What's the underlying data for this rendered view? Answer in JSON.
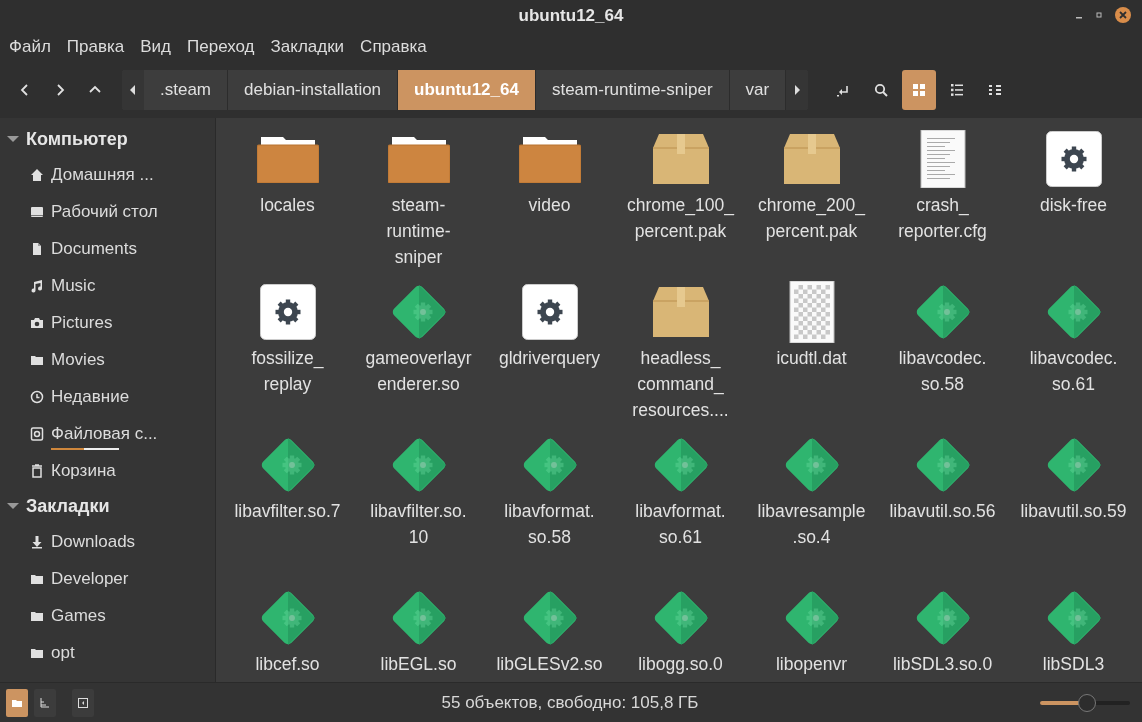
{
  "window": {
    "title": "ubuntu12_64"
  },
  "menu": [
    "Файл",
    "Правка",
    "Вид",
    "Переход",
    "Закладки",
    "Справка"
  ],
  "breadcrumbs": [
    {
      "label": ".steam",
      "selected": false
    },
    {
      "label": "debian-installation",
      "selected": false
    },
    {
      "label": "ubuntu12_64",
      "selected": true
    },
    {
      "label": "steam-runtime-sniper",
      "selected": false
    },
    {
      "label": "var",
      "selected": false
    }
  ],
  "view_buttons": [
    {
      "kind": "icons",
      "selected": true
    },
    {
      "kind": "list",
      "selected": false
    },
    {
      "kind": "compact",
      "selected": false
    }
  ],
  "sidebar": {
    "sections": [
      {
        "title": "Компьютер",
        "expanded": true,
        "items": [
          {
            "kind": "home",
            "label": "Домашняя ..."
          },
          {
            "kind": "desktop",
            "label": "Рабочий стол"
          },
          {
            "kind": "document",
            "label": "Documents"
          },
          {
            "kind": "music",
            "label": "Music"
          },
          {
            "kind": "camera",
            "label": "Pictures"
          },
          {
            "kind": "folder",
            "label": "Movies"
          },
          {
            "kind": "clock",
            "label": "Недавние"
          },
          {
            "kind": "drive",
            "label": "Файловая с...",
            "level": 0.48
          },
          {
            "kind": "trash",
            "label": "Корзина"
          }
        ]
      },
      {
        "title": "Закладки",
        "expanded": true,
        "items": [
          {
            "kind": "download",
            "label": "Downloads"
          },
          {
            "kind": "folder",
            "label": "Developer"
          },
          {
            "kind": "folder",
            "label": "Games"
          },
          {
            "kind": "folder",
            "label": "opt"
          }
        ]
      }
    ]
  },
  "files": [
    {
      "name": "locales",
      "kind": "folder"
    },
    {
      "name": "steam-runtime-sniper",
      "kind": "folder"
    },
    {
      "name": "video",
      "kind": "folder"
    },
    {
      "name": "chrome_100_percent.pak",
      "kind": "package"
    },
    {
      "name": "chrome_200_percent.pak",
      "kind": "package"
    },
    {
      "name": "crash_reporter.cfg",
      "kind": "text"
    },
    {
      "name": "disk-free",
      "kind": "executable"
    },
    {
      "name": "fossilize_replay",
      "kind": "executable"
    },
    {
      "name": "gameoverlayrenderer.so",
      "kind": "library"
    },
    {
      "name": "gldriverquery",
      "kind": "executable"
    },
    {
      "name": "headless_command_resources....",
      "kind": "package"
    },
    {
      "name": "icudtl.dat",
      "kind": "binary"
    },
    {
      "name": "libavcodec.so.58",
      "kind": "library"
    },
    {
      "name": "libavcodec.so.61",
      "kind": "library"
    },
    {
      "name": "libavfilter.so.7",
      "kind": "library"
    },
    {
      "name": "libavfilter.so.10",
      "kind": "library"
    },
    {
      "name": "libavformat.so.58",
      "kind": "library"
    },
    {
      "name": "libavformat.so.61",
      "kind": "library"
    },
    {
      "name": "libavresample.so.4",
      "kind": "library"
    },
    {
      "name": "libavutil.so.56",
      "kind": "library"
    },
    {
      "name": "libavutil.so.59",
      "kind": "library"
    },
    {
      "name": "libcef.so",
      "kind": "library"
    },
    {
      "name": "libEGL.so",
      "kind": "library"
    },
    {
      "name": "libGLESv2.so",
      "kind": "library"
    },
    {
      "name": "libogg.so.0",
      "kind": "library"
    },
    {
      "name": "libopenvr",
      "kind": "library"
    },
    {
      "name": "libSDL3.so.0",
      "kind": "library"
    },
    {
      "name": "libSDL3",
      "kind": "library"
    }
  ],
  "status_bar": {
    "text": "55 объектов, свободно: 105,8 ГБ",
    "panes": [
      {
        "kind": "places",
        "selected": true
      },
      {
        "kind": "tree",
        "selected": false
      }
    ],
    "zoom": {
      "level": 0.52
    }
  }
}
